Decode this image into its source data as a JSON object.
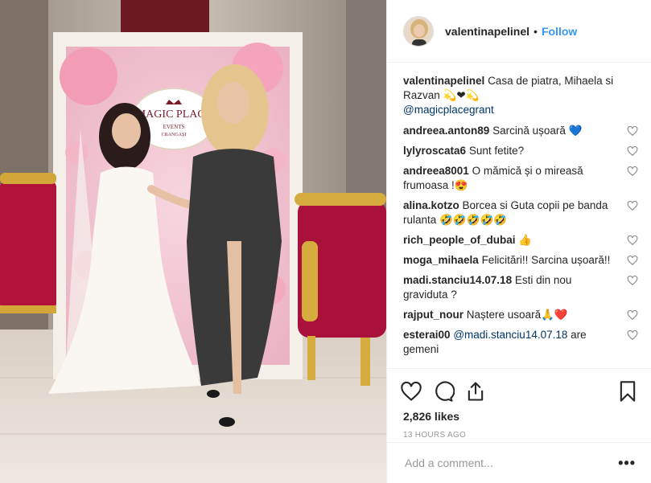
{
  "header": {
    "username": "valentinapelinel",
    "separator": "•",
    "follow": "Follow"
  },
  "photo": {
    "sign_text": "MAGIC PLACE",
    "sign_sub": "EVENTS",
    "sign_sub2": "CRANGAȘI"
  },
  "caption": {
    "user": "valentinapelinel",
    "text": "Casa de piatra, Mihaela si Razvan 💫❤💫",
    "mention": "@magicplacegrant"
  },
  "comments": [
    {
      "user": "andreea.anton89",
      "text": "Sarcină ușoară 💙"
    },
    {
      "user": "lylyroscata6",
      "text": "Sunt fetite?"
    },
    {
      "user": "andreea8001",
      "text": "O mămică și o mireasă frumoasa !😍"
    },
    {
      "user": "alina.kotzo",
      "text": "Borcea si Guta copii pe banda rulanta 🤣🤣🤣🤣🤣"
    },
    {
      "user": "rich_people_of_dubai",
      "text": "👍"
    },
    {
      "user": "moga_mihaela",
      "text": "Felicitări!! Sarcina ușoară!!"
    },
    {
      "user": "madi.stanciu14.07.18",
      "text": "Esti din nou graviduta ?"
    },
    {
      "user": "rajput_nour",
      "text": "Naștere usoară🙏❤️"
    },
    {
      "user": "esterai00",
      "mention": "@madi.stanciu14.07.18",
      "text": "are gemeni"
    }
  ],
  "likes": "2,826 likes",
  "time": "13 HOURS AGO",
  "add_comment": {
    "placeholder": "Add a comment..."
  },
  "more": "•••",
  "colors": {
    "link": "#3897f0",
    "mention": "#003569",
    "muted": "#999999"
  }
}
